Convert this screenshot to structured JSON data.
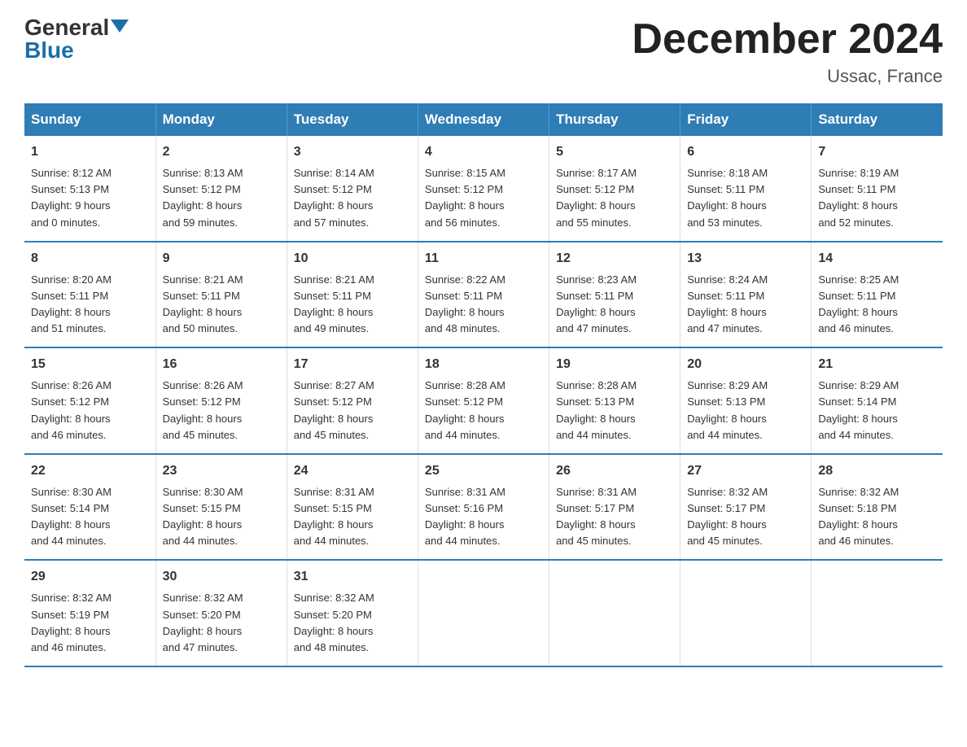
{
  "header": {
    "logo_general": "General",
    "logo_blue": "Blue",
    "title": "December 2024",
    "subtitle": "Ussac, France"
  },
  "days_of_week": [
    "Sunday",
    "Monday",
    "Tuesday",
    "Wednesday",
    "Thursday",
    "Friday",
    "Saturday"
  ],
  "weeks": [
    [
      {
        "day": "1",
        "sunrise": "8:12 AM",
        "sunset": "5:13 PM",
        "daylight": "9 hours and 0 minutes."
      },
      {
        "day": "2",
        "sunrise": "8:13 AM",
        "sunset": "5:12 PM",
        "daylight": "8 hours and 59 minutes."
      },
      {
        "day": "3",
        "sunrise": "8:14 AM",
        "sunset": "5:12 PM",
        "daylight": "8 hours and 57 minutes."
      },
      {
        "day": "4",
        "sunrise": "8:15 AM",
        "sunset": "5:12 PM",
        "daylight": "8 hours and 56 minutes."
      },
      {
        "day": "5",
        "sunrise": "8:17 AM",
        "sunset": "5:12 PM",
        "daylight": "8 hours and 55 minutes."
      },
      {
        "day": "6",
        "sunrise": "8:18 AM",
        "sunset": "5:11 PM",
        "daylight": "8 hours and 53 minutes."
      },
      {
        "day": "7",
        "sunrise": "8:19 AM",
        "sunset": "5:11 PM",
        "daylight": "8 hours and 52 minutes."
      }
    ],
    [
      {
        "day": "8",
        "sunrise": "8:20 AM",
        "sunset": "5:11 PM",
        "daylight": "8 hours and 51 minutes."
      },
      {
        "day": "9",
        "sunrise": "8:21 AM",
        "sunset": "5:11 PM",
        "daylight": "8 hours and 50 minutes."
      },
      {
        "day": "10",
        "sunrise": "8:21 AM",
        "sunset": "5:11 PM",
        "daylight": "8 hours and 49 minutes."
      },
      {
        "day": "11",
        "sunrise": "8:22 AM",
        "sunset": "5:11 PM",
        "daylight": "8 hours and 48 minutes."
      },
      {
        "day": "12",
        "sunrise": "8:23 AM",
        "sunset": "5:11 PM",
        "daylight": "8 hours and 47 minutes."
      },
      {
        "day": "13",
        "sunrise": "8:24 AM",
        "sunset": "5:11 PM",
        "daylight": "8 hours and 47 minutes."
      },
      {
        "day": "14",
        "sunrise": "8:25 AM",
        "sunset": "5:11 PM",
        "daylight": "8 hours and 46 minutes."
      }
    ],
    [
      {
        "day": "15",
        "sunrise": "8:26 AM",
        "sunset": "5:12 PM",
        "daylight": "8 hours and 46 minutes."
      },
      {
        "day": "16",
        "sunrise": "8:26 AM",
        "sunset": "5:12 PM",
        "daylight": "8 hours and 45 minutes."
      },
      {
        "day": "17",
        "sunrise": "8:27 AM",
        "sunset": "5:12 PM",
        "daylight": "8 hours and 45 minutes."
      },
      {
        "day": "18",
        "sunrise": "8:28 AM",
        "sunset": "5:12 PM",
        "daylight": "8 hours and 44 minutes."
      },
      {
        "day": "19",
        "sunrise": "8:28 AM",
        "sunset": "5:13 PM",
        "daylight": "8 hours and 44 minutes."
      },
      {
        "day": "20",
        "sunrise": "8:29 AM",
        "sunset": "5:13 PM",
        "daylight": "8 hours and 44 minutes."
      },
      {
        "day": "21",
        "sunrise": "8:29 AM",
        "sunset": "5:14 PM",
        "daylight": "8 hours and 44 minutes."
      }
    ],
    [
      {
        "day": "22",
        "sunrise": "8:30 AM",
        "sunset": "5:14 PM",
        "daylight": "8 hours and 44 minutes."
      },
      {
        "day": "23",
        "sunrise": "8:30 AM",
        "sunset": "5:15 PM",
        "daylight": "8 hours and 44 minutes."
      },
      {
        "day": "24",
        "sunrise": "8:31 AM",
        "sunset": "5:15 PM",
        "daylight": "8 hours and 44 minutes."
      },
      {
        "day": "25",
        "sunrise": "8:31 AM",
        "sunset": "5:16 PM",
        "daylight": "8 hours and 44 minutes."
      },
      {
        "day": "26",
        "sunrise": "8:31 AM",
        "sunset": "5:17 PM",
        "daylight": "8 hours and 45 minutes."
      },
      {
        "day": "27",
        "sunrise": "8:32 AM",
        "sunset": "5:17 PM",
        "daylight": "8 hours and 45 minutes."
      },
      {
        "day": "28",
        "sunrise": "8:32 AM",
        "sunset": "5:18 PM",
        "daylight": "8 hours and 46 minutes."
      }
    ],
    [
      {
        "day": "29",
        "sunrise": "8:32 AM",
        "sunset": "5:19 PM",
        "daylight": "8 hours and 46 minutes."
      },
      {
        "day": "30",
        "sunrise": "8:32 AM",
        "sunset": "5:20 PM",
        "daylight": "8 hours and 47 minutes."
      },
      {
        "day": "31",
        "sunrise": "8:32 AM",
        "sunset": "5:20 PM",
        "daylight": "8 hours and 48 minutes."
      },
      null,
      null,
      null,
      null
    ]
  ],
  "labels": {
    "sunrise": "Sunrise:",
    "sunset": "Sunset:",
    "daylight": "Daylight:"
  }
}
